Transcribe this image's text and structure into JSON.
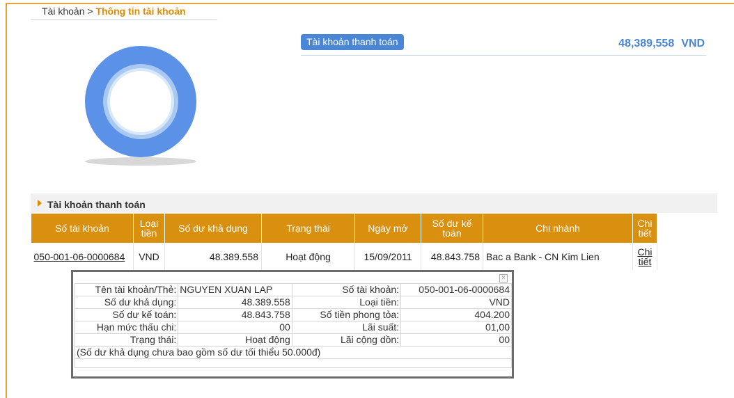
{
  "breadcrumb": {
    "root": "Tài khoản",
    "sep": ">",
    "current": "Thông tin tài khoản"
  },
  "account_summary": {
    "label": "Tài khoản thanh toán",
    "amount": "48,389,558",
    "currency": "VND"
  },
  "section": {
    "title": "Tài khoản thanh toán"
  },
  "table": {
    "headers": {
      "account_no": "Số tài khoản",
      "currency_1": "Loại",
      "currency_2": "tiền",
      "available": "Số dư khả dụng",
      "status": "Trạng thái",
      "open_date": "Ngày mở",
      "ledger_1": "Số dư kế",
      "ledger_2": "toán",
      "branch": "Chi nhánh",
      "detail_1": "Chi",
      "detail_2": "tiết"
    },
    "rows": [
      {
        "account_no": "050-001-06-0000684",
        "currency": "VND",
        "available": "48.389.558",
        "status": "Hoạt động",
        "open_date": "15/09/2011",
        "ledger": "48.843.758",
        "branch": "Bac a Bank - CN Kim Lien",
        "detail_1": "Chi",
        "detail_2": "tiết"
      }
    ]
  },
  "popup": {
    "close": "×",
    "rows": [
      {
        "l1": "Tên tài khoản/Thẻ:",
        "v1": "NGUYEN XUAN LAP",
        "l2": "Số tài khoản:",
        "v2": "050-001-06-0000684"
      },
      {
        "l1": "Số dư khả dụng:",
        "v1": "48.389.558",
        "l2": "Loại tiền:",
        "v2": "VND"
      },
      {
        "l1": "Số dư kế toán:",
        "v1": "48.843.758",
        "l2": "Số tiền phong tỏa:",
        "v2": "404.200"
      },
      {
        "l1": "Hạn mức thấu chi:",
        "v1": "00",
        "l2": "Lãi suất:",
        "v2": "01,00"
      },
      {
        "l1": "Trạng thái:",
        "v1": "Hoạt động",
        "l2": "Lãi cộng dồn:",
        "v2": "00"
      }
    ],
    "note": "(Số dư khả dụng chưa bao gồm số dư tối thiểu 50.000đ)"
  },
  "colors": {
    "accent_orange": "#d9900f",
    "accent_blue": "#4a86d6",
    "frame": "#e8a23a"
  }
}
